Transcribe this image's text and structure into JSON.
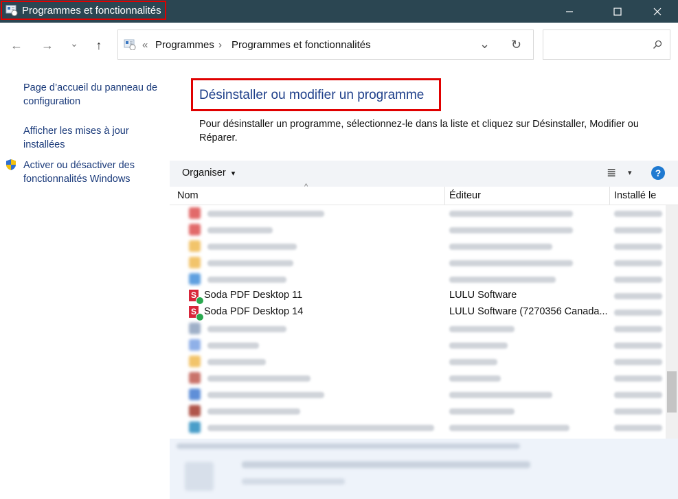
{
  "window": {
    "title": "Programmes et fonctionnalités",
    "minimize": "─",
    "maximize": "☐",
    "close": "✕"
  },
  "nav": {
    "back_icon": "←",
    "forward_icon": "→",
    "recent_icon": "⌄",
    "up_icon": "↑",
    "crumb_sep_start": "«",
    "crumbs": [
      "Programmes",
      "Programmes et fonctionnalités"
    ],
    "crumb_sep": "›",
    "dropdown_icon": "⌄",
    "refresh_icon": "↻",
    "search_placeholder": "",
    "search_icon": "⚲"
  },
  "sidebar": {
    "links": [
      "Page d’accueil du panneau de configuration",
      "Afficher les mises à jour installées",
      "Activer ou désactiver des fonctionnalités Windows"
    ]
  },
  "main": {
    "heading": "Désinstaller ou modifier un programme",
    "description": "Pour désinstaller un programme, sélectionnez-le dans la liste et cliquez sur Désinstaller, Modifier ou Réparer."
  },
  "toolbar": {
    "organize": "Organiser",
    "organize_arrow": "▾",
    "view_icon": "≣",
    "view_arrow": "▾",
    "help": "?"
  },
  "columns": {
    "name": "Nom",
    "publisher": "Éditeur",
    "installed": "Installé le",
    "sort_indicator": "^"
  },
  "programs": [
    {
      "name": "Soda PDF Desktop 11",
      "publisher": "LULU Software"
    },
    {
      "name": "Soda PDF Desktop 14",
      "publisher": "LULU Software (7270356 Canada..."
    }
  ],
  "icons": {
    "soda": "S"
  }
}
